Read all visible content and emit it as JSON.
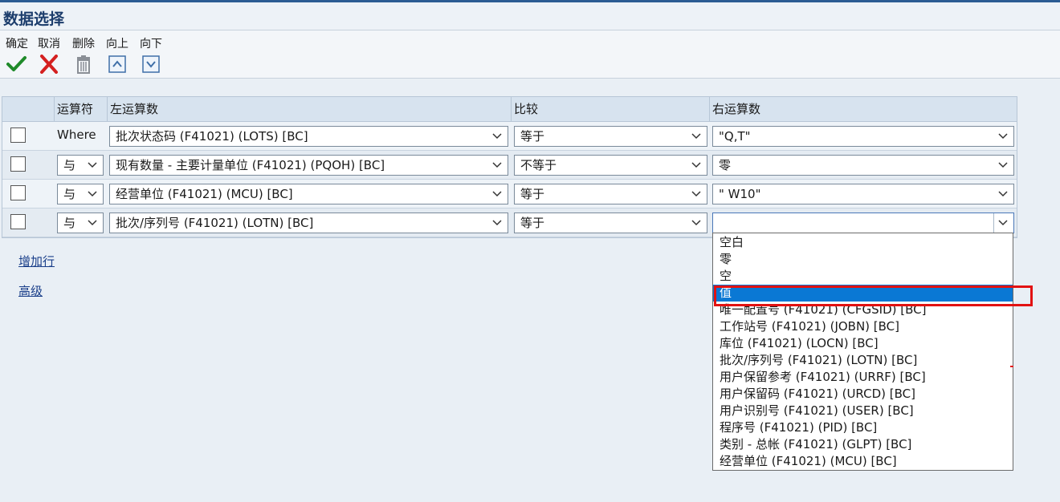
{
  "window": {
    "title": "数据选择"
  },
  "toolbar": {
    "confirm": {
      "label": "确定",
      "icon": "checkmark-icon"
    },
    "cancel": {
      "label": "取消",
      "icon": "close-icon"
    },
    "delete": {
      "label": "删除",
      "icon": "trash-icon"
    },
    "up": {
      "label": "向上",
      "icon": "arrow-up-icon"
    },
    "down": {
      "label": "向下",
      "icon": "arrow-down-icon"
    }
  },
  "grid": {
    "headers": {
      "operator": "运算符",
      "left": "左运算数",
      "compare": "比较",
      "right": "右运算数"
    },
    "rows": [
      {
        "operator": "Where",
        "left": "批次状态码 (F41021) (LOTS) [BC]",
        "compare": "等于",
        "right": "\"Q,T\""
      },
      {
        "operator": "与",
        "left": "现有数量 - 主要计量单位 (F41021) (PQOH) [BC]",
        "compare": "不等于",
        "right": "零"
      },
      {
        "operator": "与",
        "left": "经营单位 (F41021) (MCU) [BC]",
        "compare": "等于",
        "right": "\" W10\""
      },
      {
        "operator": "与",
        "left": "批次/序列号 (F41021) (LOTN) [BC]",
        "compare": "等于",
        "right": ""
      }
    ]
  },
  "links": {
    "add_row": "增加行",
    "advanced": "高级"
  },
  "dropdown": {
    "selected_index": 3,
    "options": [
      "空白",
      "零",
      "空",
      "值",
      "唯一配置号 (F41021) (CFGSID) [BC]",
      "工作站号 (F41021) (JOBN) [BC]",
      "库位 (F41021) (LOCN) [BC]",
      "批次/序列号 (F41021) (LOTN) [BC]",
      "用户保留参考 (F41021) (URRF) [BC]",
      "用户保留码 (F41021) (URCD) [BC]",
      "用户识别号 (F41021) (USER) [BC]",
      "程序号 (F41021) (PID) [BC]",
      "类别 - 总帐 (F41021) (GLPT) [BC]",
      "经营单位 (F41021) (MCU) [BC]"
    ]
  },
  "colors": {
    "accent": "#0a78d4",
    "highlight": "#e21212",
    "title": "#1c3d6c"
  }
}
